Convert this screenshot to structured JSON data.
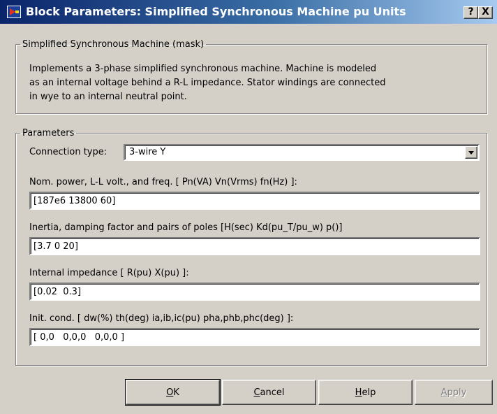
{
  "window": {
    "title": "Block Parameters: Simplified Synchronous Machine pu Units",
    "help_button": "?",
    "close_button": "X"
  },
  "description_group": {
    "legend": "Simplified Synchronous Machine (mask)",
    "lines": [
      "Implements a 3-phase simplified synchronous machine. Machine is modeled",
      "as an internal voltage behind a R-L impedance. Stator windings are connected",
      "in wye to an internal neutral point."
    ]
  },
  "parameters_group": {
    "legend": "Parameters",
    "connection_type": {
      "label": "Connection type:",
      "value": "3-wire Y"
    },
    "fields": [
      {
        "label": "Nom. power, L-L volt., and freq. [ Pn(VA) Vn(Vrms) fn(Hz) ]:",
        "value": "[187e6 13800 60]"
      },
      {
        "label": "Inertia, damping factor and pairs of poles [H(sec) Kd(pu_T/pu_w) p()]",
        "value": "[3.7 0 20]"
      },
      {
        "label": "Internal impedance [ R(pu)  X(pu) ]:",
        "value": "[0.02  0.3]"
      },
      {
        "label": "Init. cond. [ dw(%)  th(deg)  ia,ib,ic(pu)  pha,phb,phc(deg) ]:",
        "value": "[ 0,0   0,0,0   0,0,0 ]"
      }
    ]
  },
  "buttons": {
    "ok": {
      "mnemonic": "O",
      "rest": "K"
    },
    "cancel": {
      "mnemonic": "C",
      "rest": "ancel"
    },
    "help": {
      "mnemonic": "H",
      "rest": "elp"
    },
    "apply": {
      "mnemonic": "A",
      "rest": "pply"
    }
  }
}
